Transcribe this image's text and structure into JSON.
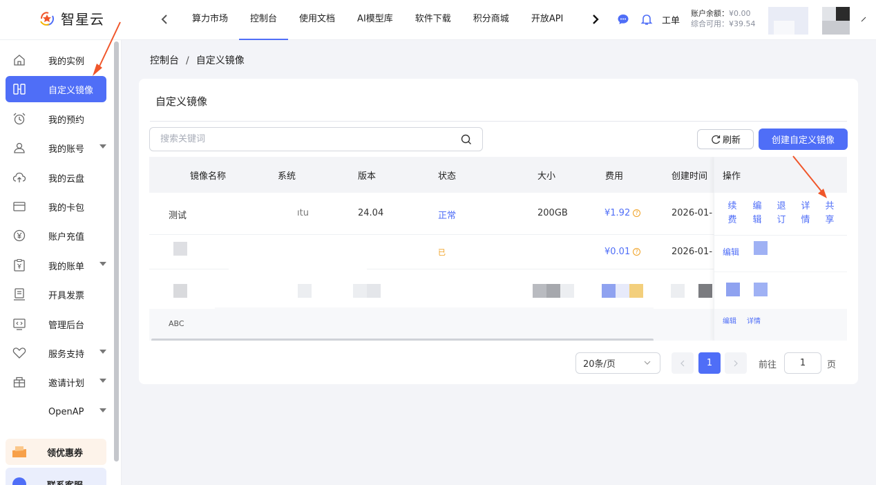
{
  "brand": {
    "name": "智星云"
  },
  "nav": {
    "tabs": [
      "算力市场",
      "控制台",
      "使用文档",
      "AI模型库",
      "软件下载",
      "积分商城",
      "开放API"
    ],
    "active_index": 1,
    "ticket_label": "工单"
  },
  "account": {
    "balance_label": "账户余额：",
    "balance_value": "¥0.00",
    "available_label": "综合可用：",
    "available_value": "¥39.54"
  },
  "sidebar": {
    "items": [
      {
        "label": "我的实例",
        "icon": "home-icon"
      },
      {
        "label": "自定义镜像",
        "icon": "image-icon",
        "active": true
      },
      {
        "label": "我的预约",
        "icon": "alarm-clock-icon"
      },
      {
        "label": "我的账号",
        "icon": "user-icon",
        "caret": true
      },
      {
        "label": "我的云盘",
        "icon": "cloud-icon"
      },
      {
        "label": "我的卡包",
        "icon": "card-icon"
      },
      {
        "label": "账户充值",
        "icon": "yen-coin-icon"
      },
      {
        "label": "我的账单",
        "icon": "bill-icon",
        "caret": true
      },
      {
        "label": "开具发票",
        "icon": "invoice-icon"
      },
      {
        "label": "管理后台",
        "icon": "admin-icon"
      },
      {
        "label": "服务支持",
        "icon": "support-icon",
        "caret": true
      },
      {
        "label": "邀请计划",
        "icon": "gift-icon",
        "caret": true
      },
      {
        "label": "OpenAP",
        "icon": "",
        "caret": true
      }
    ],
    "promos": [
      {
        "label": "领优惠券",
        "icon": "coupon-icon"
      },
      {
        "label": "联系客服",
        "icon": "service-icon"
      }
    ]
  },
  "breadcrumb": {
    "root": "控制台",
    "sep": "/",
    "current": "自定义镜像"
  },
  "card": {
    "title": "自定义镜像",
    "search_placeholder": "搜索关键词",
    "refresh_label": "刷新",
    "create_label": "创建自定义镜像"
  },
  "table": {
    "columns": [
      "镜像名称",
      "系统",
      "版本",
      "状态",
      "大小",
      "费用",
      "创建时间",
      "操作"
    ],
    "rows": [
      {
        "name": "测试",
        "system": "ıtu",
        "version": "24.04",
        "status": "正常",
        "size": "200GB",
        "fee": "¥1.92",
        "created": "2026-01-"
      },
      {
        "name": "",
        "system": "",
        "version": "",
        "status": "已",
        "size": "",
        "fee": "¥0.01",
        "created": "2026-01-"
      },
      {
        "name": "",
        "system": "",
        "version": "",
        "status": "",
        "size": "",
        "fee": "",
        "created": ""
      },
      {
        "name": "ABC",
        "system": "",
        "version": "",
        "status": "",
        "size": "",
        "fee": "",
        "created": ""
      }
    ],
    "row1_ops": [
      "续费",
      "编辑",
      "退订",
      "详情",
      "共享"
    ],
    "row2_op": "编辑",
    "row4_ops": [
      "编辑",
      "详情"
    ]
  },
  "pagination": {
    "page_size": "20条/页",
    "current_page": "1",
    "goto_label": "前往",
    "goto_value": "1",
    "page_suffix": "页"
  },
  "colors": {
    "accent": "#4f6ef7",
    "warning": "#f0a020",
    "annotation": "#f0562a"
  }
}
